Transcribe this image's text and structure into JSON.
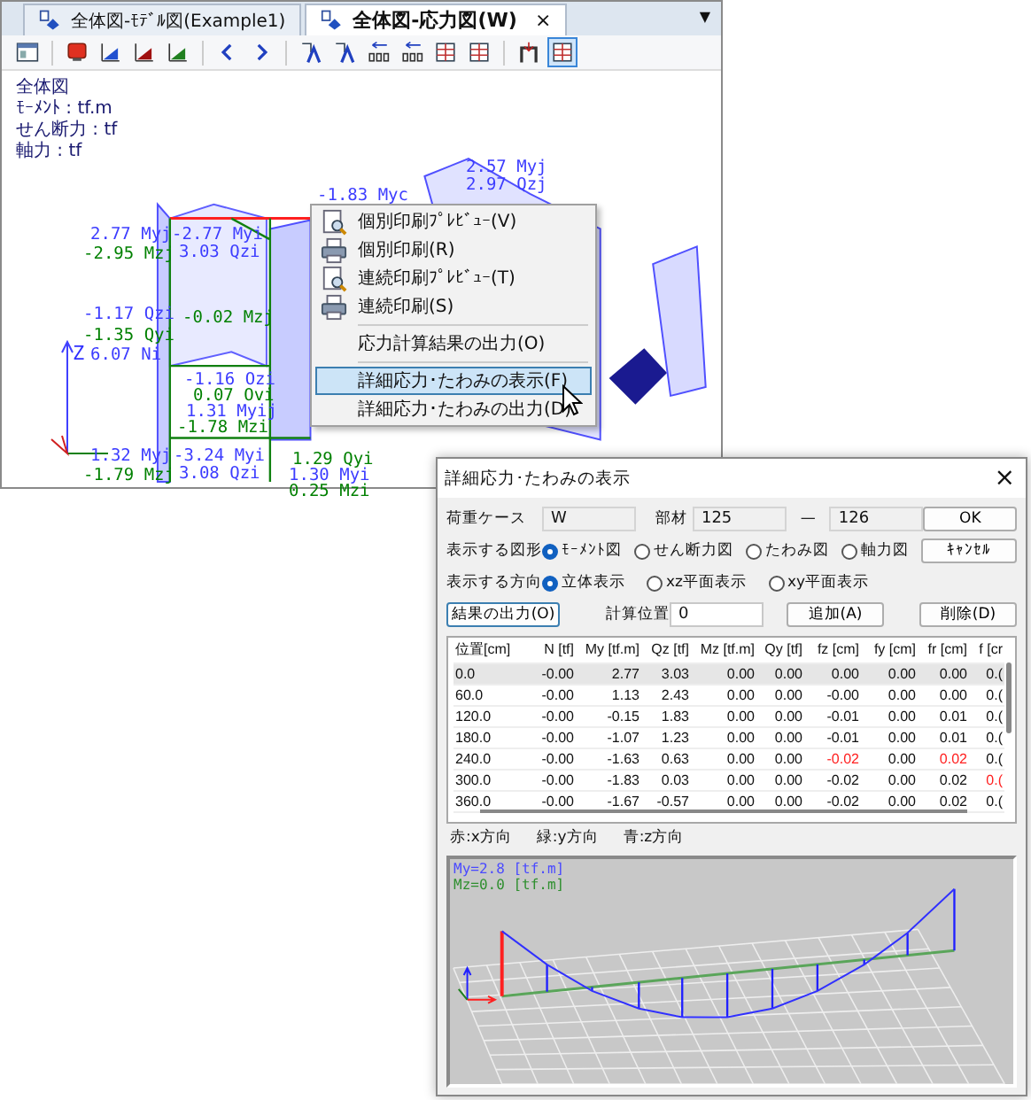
{
  "tabs": [
    {
      "label": "全体図-ﾓﾃﾞﾙ図(Example1)",
      "selected": false,
      "closable": false
    },
    {
      "label": "全体図-応力図(W)",
      "selected": true,
      "closable": true
    }
  ],
  "tab_close": "×",
  "tab_menu": "▼",
  "toolbar": [
    [
      {
        "kind": "window",
        "selected": false
      }
    ],
    [
      {
        "kind": "screen",
        "selected": false
      },
      {
        "kind": "chart",
        "color": "#2050d0",
        "selected": false
      },
      {
        "kind": "chart",
        "color": "#a01010",
        "selected": false
      },
      {
        "kind": "chart",
        "color": "#208020",
        "selected": false
      }
    ],
    [
      {
        "kind": "prev",
        "selected": false
      },
      {
        "kind": "next",
        "selected": false
      }
    ],
    [
      {
        "kind": "label",
        "selected": false
      },
      {
        "kind": "label",
        "selected": false
      },
      {
        "kind": "digits",
        "selected": false
      },
      {
        "kind": "digits",
        "selected": false
      },
      {
        "kind": "table",
        "selected": false
      },
      {
        "kind": "table",
        "selected": false
      }
    ],
    [
      {
        "kind": "frame",
        "selected": false
      },
      {
        "kind": "table",
        "selected": true
      }
    ]
  ],
  "legend": [
    "全体図",
    "ﾓｰﾒﾝﾄ : tf.m",
    "せん断力 : tf",
    "軸力 : tf"
  ],
  "axis_label": "Z",
  "labels": [
    {
      "text": "-1.83 Myc",
      "color": "#3c3cff"
    },
    {
      "text": "2.57 Myj",
      "color": "#3c3cff"
    },
    {
      "text": "2.97 Qzj",
      "color": "#3c3cff"
    },
    {
      "text": "2.77 Myj",
      "color": "#3c3cff"
    },
    {
      "text": "-2.95 Mzj",
      "color": "#008000"
    },
    {
      "text": "-2.77 Myi",
      "color": "#3c3cff"
    },
    {
      "text": "3.03 Qzi",
      "color": "#3c3cff"
    },
    {
      "text": "-1.17 Qzi",
      "color": "#3c3cff"
    },
    {
      "text": "-1.35 Qyi",
      "color": "#008000"
    },
    {
      "text": "6.07 Ni",
      "color": "#3c3cff"
    },
    {
      "text": "-0.02 Mzj",
      "color": "#008000"
    },
    {
      "text": "-1.16 Ozi",
      "color": "#3c3cff"
    },
    {
      "text": "0.07 Ovi",
      "color": "#008000"
    },
    {
      "text": "1.31 Myij",
      "color": "#3c3cff"
    },
    {
      "text": "-1.78 Mzi",
      "color": "#008000"
    },
    {
      "text": "1.32 Myj",
      "color": "#3c3cff"
    },
    {
      "text": "-1.79 Mzj",
      "color": "#008000"
    },
    {
      "text": "-3.24 Myi",
      "color": "#3c3cff"
    },
    {
      "text": "3.08 Qzi",
      "color": "#3c3cff"
    },
    {
      "text": "1.29 Qyi",
      "color": "#008000"
    },
    {
      "text": "1.30 Myi",
      "color": "#3c3cff"
    },
    {
      "text": "0.25 Mzi",
      "color": "#008000"
    }
  ],
  "context_menu": [
    {
      "kind": "preview",
      "label": "個別印刷ﾌﾟﾚﾋﾞｭｰ(V)",
      "selected": false
    },
    {
      "kind": "print",
      "label": "個別印刷(R)",
      "selected": false
    },
    {
      "kind": "preview",
      "label": "連続印刷ﾌﾟﾚﾋﾞｭｰ(T)",
      "selected": false
    },
    {
      "kind": "print",
      "label": "連続印刷(S)",
      "selected": false
    },
    {
      "kind": "separator"
    },
    {
      "kind": "item",
      "label": "応力計算結果の出力(O)",
      "selected": false
    },
    {
      "kind": "separator"
    },
    {
      "kind": "item",
      "label": "詳細応力･たわみの表示(F)",
      "selected": true
    },
    {
      "kind": "item",
      "label": "詳細応力･たわみの出力(D)",
      "selected": false
    }
  ],
  "dialog": {
    "title": "詳細応力･たわみの表示",
    "close": "×",
    "load_case": {
      "label": "荷重ケース",
      "value": "W"
    },
    "member": {
      "label": "部材",
      "from": "125",
      "dash": "—",
      "to": "126"
    },
    "ok": "OK",
    "cancel": "ｷｬﾝｾﾙ",
    "figure": {
      "label": "表示する図形",
      "options": [
        {
          "label": "ﾓｰﾒﾝﾄ図",
          "selected": true
        },
        {
          "label": "せん断力図",
          "selected": false
        },
        {
          "label": "たわみ図",
          "selected": false
        },
        {
          "label": "軸力図",
          "selected": false
        }
      ]
    },
    "direction": {
      "label": "表示する方向",
      "options": [
        {
          "label": "立体表示",
          "selected": true
        },
        {
          "label": "xz平面表示",
          "selected": false
        },
        {
          "label": "xy平面表示",
          "selected": false
        }
      ]
    },
    "output": "結果の出力(O)",
    "position": {
      "label": "計算位置",
      "value": "0"
    },
    "add": "追加(A)",
    "delete": "削除(D)",
    "table": {
      "columns": [
        "位置[cm]",
        "N [tf]",
        "My [tf.m]",
        "Qz [tf]",
        "Mz [tf.m]",
        "Qy [tf]",
        "fz [cm]",
        "fy [cm]",
        "fr [cm]",
        "f [cr"
      ],
      "rows": [
        {
          "selected": true,
          "cells": [
            "0.0",
            "-0.00",
            "2.77",
            "3.03",
            "0.00",
            "0.00",
            "0.00",
            "0.00",
            "0.00",
            "0.("
          ],
          "red": [
            false,
            false,
            false,
            false,
            false,
            false,
            false,
            false,
            false,
            false
          ]
        },
        {
          "selected": false,
          "cells": [
            "60.0",
            "-0.00",
            "1.13",
            "2.43",
            "0.00",
            "0.00",
            "-0.00",
            "0.00",
            "0.00",
            "0.("
          ],
          "red": [
            false,
            false,
            false,
            false,
            false,
            false,
            false,
            false,
            false,
            false
          ]
        },
        {
          "selected": false,
          "cells": [
            "120.0",
            "-0.00",
            "-0.15",
            "1.83",
            "0.00",
            "0.00",
            "-0.01",
            "0.00",
            "0.01",
            "0.("
          ],
          "red": [
            false,
            false,
            false,
            false,
            false,
            false,
            false,
            false,
            false,
            false
          ]
        },
        {
          "selected": false,
          "cells": [
            "180.0",
            "-0.00",
            "-1.07",
            "1.23",
            "0.00",
            "0.00",
            "-0.01",
            "0.00",
            "0.01",
            "0.("
          ],
          "red": [
            false,
            false,
            false,
            false,
            false,
            false,
            false,
            false,
            false,
            false
          ]
        },
        {
          "selected": false,
          "cells": [
            "240.0",
            "-0.00",
            "-1.63",
            "0.63",
            "0.00",
            "0.00",
            "-0.02",
            "0.00",
            "0.02",
            "0.("
          ],
          "red": [
            false,
            false,
            false,
            false,
            false,
            false,
            true,
            false,
            true,
            false
          ]
        },
        {
          "selected": false,
          "cells": [
            "300.0",
            "-0.00",
            "-1.83",
            "0.03",
            "0.00",
            "0.00",
            "-0.02",
            "0.00",
            "0.02",
            "0.("
          ],
          "red": [
            false,
            false,
            false,
            false,
            false,
            false,
            false,
            false,
            false,
            true
          ]
        },
        {
          "selected": false,
          "cells": [
            "360.0",
            "-0.00",
            "-1.67",
            "-0.57",
            "0.00",
            "0.00",
            "-0.02",
            "0.00",
            "0.02",
            "0.("
          ],
          "red": [
            false,
            false,
            false,
            false,
            false,
            false,
            false,
            false,
            false,
            false
          ]
        }
      ]
    },
    "axis_legend": [
      {
        "text": "赤:x方向"
      },
      {
        "text": "緑:y方向"
      },
      {
        "text": "青:z方向"
      }
    ],
    "graph_labels": [
      {
        "text": "My=2.8 [tf.m]",
        "color": "#4a4aff"
      },
      {
        "text": "Mz=0.0 [tf.m]",
        "color": "#2f8f2f"
      }
    ]
  }
}
